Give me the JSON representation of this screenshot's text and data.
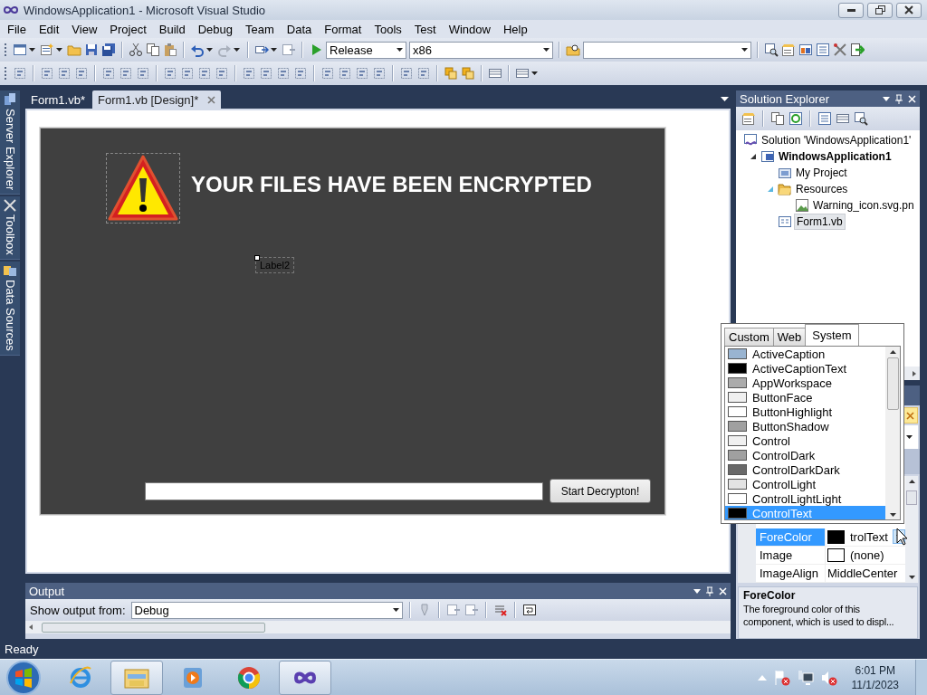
{
  "window": {
    "title": "WindowsApplication1 - Microsoft Visual Studio"
  },
  "menu": [
    "File",
    "Edit",
    "View",
    "Project",
    "Build",
    "Debug",
    "Team",
    "Data",
    "Format",
    "Tools",
    "Test",
    "Window",
    "Help"
  ],
  "toolbar": {
    "configuration": "Release",
    "platform": "x86"
  },
  "side_tabs": [
    "Server Explorer",
    "Toolbox",
    "Data Sources"
  ],
  "document_tabs": [
    {
      "label": "Form1.vb*",
      "selected": false
    },
    {
      "label": "Form1.vb [Design]*",
      "selected": true
    }
  ],
  "form": {
    "heading": "YOUR FILES HAVE BEEN ENCRYPTED",
    "label": "Label2",
    "button": "Start Decrypton!"
  },
  "solution_explorer": {
    "title": "Solution Explorer",
    "tree": [
      {
        "label": "Solution 'WindowsApplication1'",
        "kind": "solution",
        "bold": false,
        "selected": false,
        "children": [
          {
            "label": "WindowsApplication1",
            "kind": "project",
            "bold": true,
            "selected": false,
            "expanded": true,
            "children": [
              {
                "label": "My Project",
                "kind": "properties",
                "bold": false,
                "selected": false
              },
              {
                "label": "Resources",
                "kind": "folder",
                "bold": false,
                "selected": false,
                "expanded": true,
                "children": [
                  {
                    "label": "Warning_icon.svg.pn",
                    "kind": "image",
                    "bold": false,
                    "selected": false
                  }
                ]
              },
              {
                "label": "Form1.vb",
                "kind": "form",
                "bold": false,
                "selected": true
              }
            ]
          }
        ]
      }
    ]
  },
  "color_picker": {
    "tabs": [
      {
        "label": "Custom",
        "selected": false
      },
      {
        "label": "Web",
        "selected": false
      },
      {
        "label": "System",
        "selected": true
      }
    ],
    "colors": [
      {
        "name": "ActiveCaption",
        "color": "#99b4d1",
        "selected": false
      },
      {
        "name": "ActiveCaptionText",
        "color": "#000000",
        "selected": false
      },
      {
        "name": "AppWorkspace",
        "color": "#ababab",
        "selected": false
      },
      {
        "name": "ButtonFace",
        "color": "#f0f0f0",
        "selected": false
      },
      {
        "name": "ButtonHighlight",
        "color": "#ffffff",
        "selected": false
      },
      {
        "name": "ButtonShadow",
        "color": "#a0a0a0",
        "selected": false
      },
      {
        "name": "Control",
        "color": "#f0f0f0",
        "selected": false
      },
      {
        "name": "ControlDark",
        "color": "#a0a0a0",
        "selected": false
      },
      {
        "name": "ControlDarkDark",
        "color": "#696969",
        "selected": false
      },
      {
        "name": "ControlLight",
        "color": "#e3e3e3",
        "selected": false
      },
      {
        "name": "ControlLightLight",
        "color": "#ffffff",
        "selected": false
      },
      {
        "name": "ControlText",
        "color": "#000000",
        "selected": true
      }
    ]
  },
  "properties": {
    "rows": [
      {
        "name": "ForeColor",
        "value": "trolText",
        "color": "#000000",
        "selected": true
      },
      {
        "name": "Image",
        "value": "(none)",
        "color": "#ffffff",
        "selected": false
      },
      {
        "name": "ImageAlign",
        "value": "MiddleCenter",
        "selected": false
      }
    ],
    "description": {
      "title": "ForeColor",
      "text": "The foreground color of this component, which is used to displ..."
    }
  },
  "output": {
    "title": "Output",
    "source_label": "Show output from:",
    "source": "Debug"
  },
  "status_bar": "Ready",
  "taskbar": {
    "buttons": [
      {
        "kind": "browser",
        "open": false
      },
      {
        "kind": "folder",
        "open": true
      },
      {
        "kind": "media",
        "open": false
      },
      {
        "kind": "round-browser",
        "open": false
      },
      {
        "kind": "studio",
        "open": true
      }
    ],
    "time": "6:01 PM",
    "date": "11/1/2023"
  }
}
